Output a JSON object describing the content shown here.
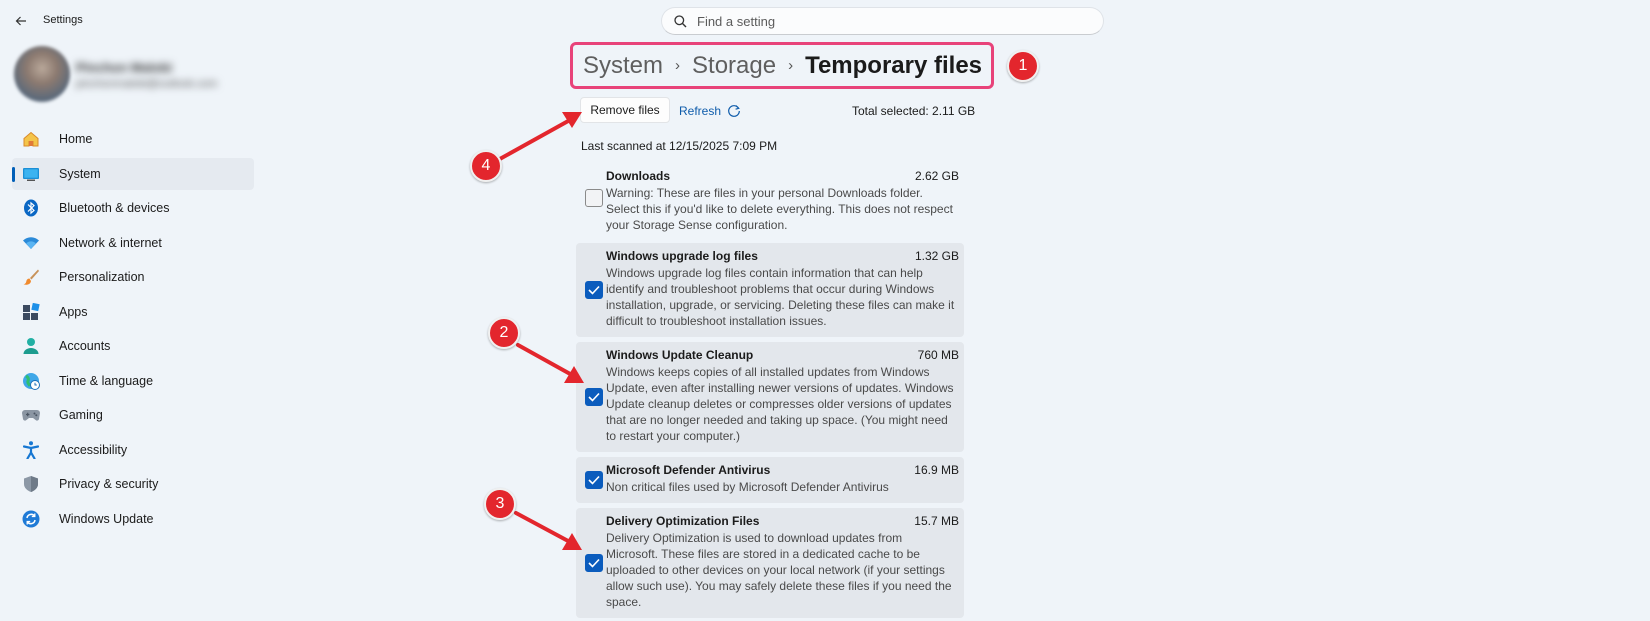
{
  "window": {
    "title": "Settings",
    "search_placeholder": "Find a setting"
  },
  "profile": {
    "name": "Pinchon Malobi",
    "email": "pinchonmalobi@outlook.com"
  },
  "sidebar": {
    "items": [
      {
        "label": "Home",
        "icon": "home-icon"
      },
      {
        "label": "System",
        "icon": "system-icon"
      },
      {
        "label": "Bluetooth & devices",
        "icon": "bluetooth-icon"
      },
      {
        "label": "Network & internet",
        "icon": "wifi-icon"
      },
      {
        "label": "Personalization",
        "icon": "brush-icon"
      },
      {
        "label": "Apps",
        "icon": "apps-icon"
      },
      {
        "label": "Accounts",
        "icon": "account-icon"
      },
      {
        "label": "Time & language",
        "icon": "globe-icon"
      },
      {
        "label": "Gaming",
        "icon": "gamepad-icon"
      },
      {
        "label": "Accessibility",
        "icon": "accessibility-icon"
      },
      {
        "label": "Privacy & security",
        "icon": "shield-icon"
      },
      {
        "label": "Windows Update",
        "icon": "update-icon"
      }
    ],
    "active_item": "System"
  },
  "breadcrumb": {
    "items": [
      "System",
      "Storage",
      "Temporary files"
    ],
    "separator": "›"
  },
  "toolbar": {
    "remove_label": "Remove files",
    "refresh_label": "Refresh",
    "total_selected": "Total selected: 2.11 GB"
  },
  "last_scanned": "Last scanned at 12/15/2025 7:09 PM",
  "files": [
    {
      "name": "Downloads",
      "size": "2.62 GB",
      "checked": false,
      "description": "Warning: These are files in your personal Downloads folder. Select this if you'd like to delete everything. This does not respect your Storage Sense configuration."
    },
    {
      "name": "Windows upgrade log files",
      "size": "1.32 GB",
      "checked": true,
      "description": "Windows upgrade log files contain information that can help identify and troubleshoot problems that occur during Windows installation, upgrade, or servicing.  Deleting these files can make it difficult to troubleshoot installation issues."
    },
    {
      "name": "Windows Update Cleanup",
      "size": "760 MB",
      "checked": true,
      "description": "Windows keeps copies of all installed updates from Windows Update, even after installing newer versions of updates. Windows Update cleanup deletes or compresses older versions of updates that are no longer needed and taking up space. (You might need to restart your computer.)"
    },
    {
      "name": "Microsoft Defender Antivirus",
      "size": "16.9 MB",
      "checked": true,
      "description": "Non critical files used by Microsoft Defender Antivirus"
    },
    {
      "name": "Delivery Optimization Files",
      "size": "15.7 MB",
      "checked": true,
      "description": "Delivery Optimization is used to download updates from Microsoft. These files are stored in a dedicated cache to be uploaded to other devices on your local network (if your settings allow such use). You may safely delete these files if you need the space."
    }
  ],
  "annotations": [
    "1",
    "2",
    "3",
    "4"
  ],
  "colors": {
    "accent": "#005fb8",
    "annotation_red": "#e3262d",
    "highlight_pink": "#e8437a"
  }
}
